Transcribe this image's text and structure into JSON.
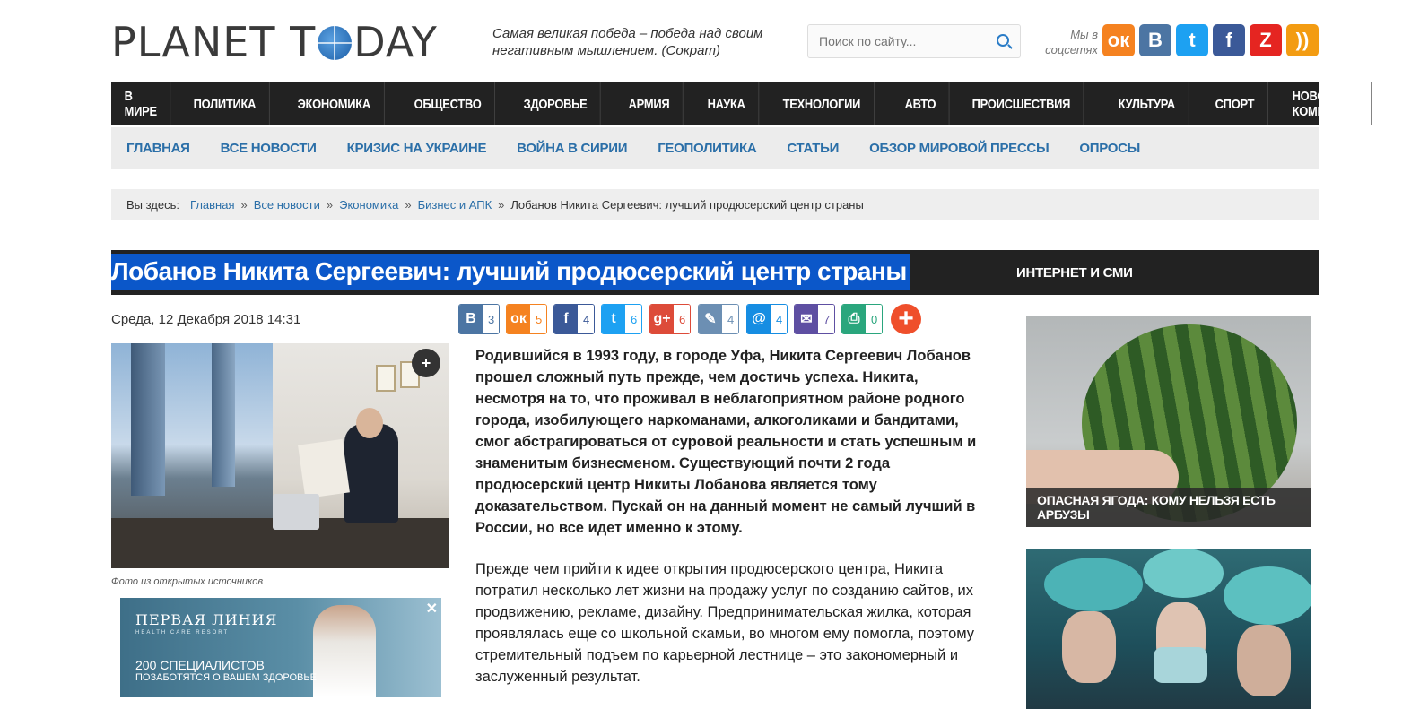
{
  "header": {
    "logo": {
      "part1": "PLANET T",
      "part2": "DAY"
    },
    "quote": "Самая великая победа – победа над своим негативным мышлением. (Сократ)",
    "search_placeholder": "Поиск по сайту...",
    "social_label": "Мы в соцсетях",
    "social": [
      {
        "name": "odnoklassniki",
        "glyph": "ок",
        "color": "#f58220"
      },
      {
        "name": "vkontakte",
        "glyph": "В",
        "color": "#4c75a3"
      },
      {
        "name": "twitter",
        "glyph": "t",
        "color": "#1da1f2"
      },
      {
        "name": "facebook",
        "glyph": "f",
        "color": "#3b5998"
      },
      {
        "name": "zen",
        "glyph": "Z",
        "color": "#e52521"
      },
      {
        "name": "rss",
        "glyph": "))",
        "color": "#f39c12"
      }
    ]
  },
  "nav_main": [
    "В МИРЕ",
    "ПОЛИТИКА",
    "ЭКОНОМИКА",
    "ОБЩЕСТВО",
    "ЗДОРОВЬЕ",
    "АРМИЯ",
    "НАУКА",
    "ТЕХНОЛОГИИ",
    "АВТО",
    "ПРОИСШЕСТВИЯ",
    "КУЛЬТУРА",
    "СПОРТ",
    "НОВОСТИ КОМПАНИЙ"
  ],
  "nav_sub": [
    "ГЛАВНАЯ",
    "ВСЕ НОВОСТИ",
    "КРИЗИС НА УКРАИНЕ",
    "ВОЙНА В СИРИИ",
    "ГЕОПОЛИТИКА",
    "СТАТЬИ",
    "ОБЗОР МИРОВОЙ ПРЕССЫ",
    "ОПРОСЫ"
  ],
  "breadcrumb": {
    "prefix": "Вы здесь:",
    "links": [
      "Главная",
      "Все новости",
      "Экономика",
      "Бизнес и АПК"
    ],
    "separator": "»",
    "current": "Лобанов Никита Сергеевич: лучший продюсерский центр страны"
  },
  "article": {
    "title": "Лобанов Никита Сергеевич: лучший продюсерский центр страны",
    "date": "Среда, 12 Декабря 2018 14:31",
    "photo_caption": "Фото из открытых источников",
    "paragraph1": "Родившийся в 1993 году, в городе Уфа, Никита Сергеевич Лобанов прошел сложный путь прежде, чем достичь успеха. Никита, несмотря на то, что проживал в неблагоприятном районе родного города, изобилующего наркоманами, алкоголиками и бандитами, смог абстрагироваться от суровой реальности и стать успешным и знаменитым бизнесменом.  Существующий почти 2 года продюсерский центр Никиты Лобанова является тому доказательством. Пускай он на данный момент не самый лучший в России, но все идет именно к этому.",
    "paragraph2": "Прежде чем прийти к идее открытия продюсерского центра, Никита потратил несколько лет жизни на продажу услуг по созданию сайтов, их продвижению, рекламе, дизайну. Предпринимательская жилка, которая проявлялась еще со школьной скамьи, во многом ему помогла, поэтому стремительный подъем по карьерной лестнице – это закономерный и заслуженный результат."
  },
  "share": [
    {
      "name": "vk",
      "glyph": "В",
      "count": "3",
      "color": "#4c75a3"
    },
    {
      "name": "ok",
      "glyph": "ок",
      "count": "5",
      "color": "#f58220"
    },
    {
      "name": "facebook",
      "glyph": "f",
      "count": "4",
      "color": "#3b5998"
    },
    {
      "name": "twitter",
      "glyph": "t",
      "count": "6",
      "color": "#1da1f2"
    },
    {
      "name": "googleplus",
      "glyph": "g+",
      "count": "6",
      "color": "#dd4b39"
    },
    {
      "name": "livejournal",
      "glyph": "✎",
      "count": "4",
      "color": "#6c8fb3"
    },
    {
      "name": "mailru",
      "glyph": "@",
      "count": "4",
      "color": "#168de2"
    },
    {
      "name": "email",
      "glyph": "✉",
      "count": "7",
      "color": "#5e4fa2"
    },
    {
      "name": "print",
      "glyph": "⎙",
      "count": "0",
      "color": "#2aa67d"
    }
  ],
  "share_more": "+",
  "ad": {
    "brand": "ПЕРВАЯ ЛИНИЯ",
    "brand_sub": "HEALTH CARE RESORT",
    "line1": "200 СПЕЦИАЛИСТОВ",
    "line2": "ПОЗАБОТЯТСЯ О ВАШЕМ ЗДОРОВЬЕ",
    "close": "✕"
  },
  "sidebar": {
    "heading": "ИНТЕРНЕТ И СМИ",
    "card1_caption": "ОПАСНАЯ ЯГОДА: КОМУ НЕЛЬЗЯ ЕСТЬ АРБУЗЫ"
  }
}
